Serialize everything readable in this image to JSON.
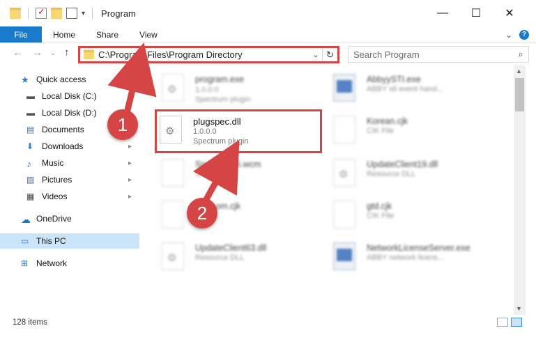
{
  "titlebar": {
    "title": "Program",
    "minimize_icon": "minimize-icon",
    "maximize_icon": "maximize-icon",
    "close_icon": "close-icon",
    "minimize_glyph": "—",
    "maximize_glyph": "☐",
    "close_glyph": "✕"
  },
  "ribbon": {
    "file_label": "File",
    "tabs": [
      {
        "label": "Home"
      },
      {
        "label": "Share"
      },
      {
        "label": "View"
      }
    ],
    "expand_glyph": "⌄",
    "help_glyph": "?"
  },
  "nav_buttons": {
    "back": "←",
    "forward": "→",
    "recent": "⌄",
    "up": "↑"
  },
  "address": {
    "path": "C:\\Program Files\\Program Directory",
    "chevron": "⌄",
    "refresh": "↻"
  },
  "search": {
    "placeholder": "Search Program",
    "icon": "⌕"
  },
  "sidebar": {
    "items": [
      {
        "label": "Quick access",
        "icon": "star-icon",
        "glyph": "★",
        "color": "#2e7bd6",
        "pinned": false
      },
      {
        "label": "Local Disk (C:)",
        "icon": "drive-icon",
        "glyph": "▬",
        "color": "#555555",
        "pinned": true
      },
      {
        "label": "Local Disk (D:)",
        "icon": "drive-icon",
        "glyph": "▬",
        "color": "#555555",
        "pinned": true
      },
      {
        "label": "Documents",
        "icon": "documents-icon",
        "glyph": "▤",
        "color": "#4a6fa5",
        "pinned": true
      },
      {
        "label": "Downloads",
        "icon": "downloads-icon",
        "glyph": "⬇",
        "color": "#2e7bd6",
        "pinned": true
      },
      {
        "label": "Music",
        "icon": "music-icon",
        "glyph": "♪",
        "color": "#2e7bd6",
        "pinned": true
      },
      {
        "label": "Pictures",
        "icon": "pictures-icon",
        "glyph": "▨",
        "color": "#4a6fa5",
        "pinned": true
      },
      {
        "label": "Videos",
        "icon": "videos-icon",
        "glyph": "▦",
        "color": "#444444",
        "pinned": true
      },
      {
        "label": "OneDrive",
        "icon": "onedrive-icon",
        "glyph": "☁",
        "color": "#1979ca",
        "pinned": false
      },
      {
        "label": "This PC",
        "icon": "this-pc-icon",
        "glyph": "▭",
        "color": "#2e7bd6",
        "pinned": false
      },
      {
        "label": "Network",
        "icon": "network-icon",
        "glyph": "⊞",
        "color": "#2e7bd6",
        "pinned": false
      }
    ],
    "pin_glyph": "📌"
  },
  "files": [
    {
      "name": "program.exe",
      "version": "1.0.0.0",
      "description": "Spectrum plugin",
      "icon": "exe-icon"
    },
    {
      "name": "AbbyySTI.exe",
      "version": "",
      "description": "ABBY sti event hand...",
      "icon": "app-icon"
    },
    {
      "name": "plugspec.dll",
      "version": "1.0.0.0",
      "description": "Spectrum plugin",
      "icon": "dll-gear-icon"
    },
    {
      "name": "Korean.cjk",
      "version": "",
      "description": "CIK File",
      "icon": "file-icon"
    },
    {
      "name": "Snd·····P15.wcm",
      "version": "",
      "description": "WCM File",
      "icon": "file-icon"
    },
    {
      "name": "UpdateClient19.dll",
      "version": "",
      "description": "Resource DLL",
      "icon": "dll-gear-icon"
    },
    {
      "name": "·······om.cjk",
      "version": "",
      "description": "·····",
      "icon": "file-icon"
    },
    {
      "name": "gtd.cjk",
      "version": "",
      "description": "CIK File",
      "icon": "file-icon"
    },
    {
      "name": "UpdateClient63.dll",
      "version": "",
      "description": "Resource DLL",
      "icon": "dll-gear-icon"
    },
    {
      "name": "NetworkLicenseServer.exe",
      "version": "",
      "description": "ABBY network licens...",
      "icon": "app-icon"
    }
  ],
  "statusbar": {
    "item_count": "128 items"
  },
  "callouts": [
    {
      "label": "1"
    },
    {
      "label": "2"
    }
  ],
  "colors": {
    "accent": "#1979ca",
    "highlight_red": "#d64545",
    "selection": "#cce4f7"
  }
}
